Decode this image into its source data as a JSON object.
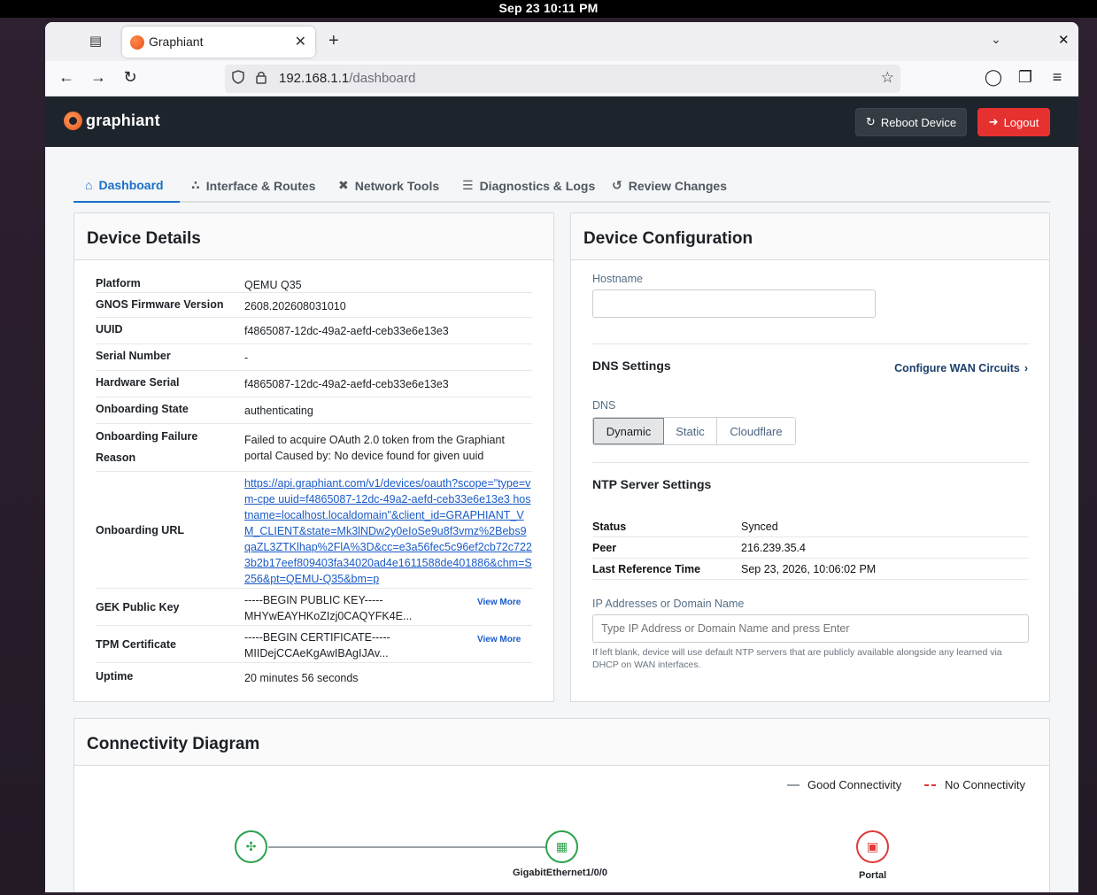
{
  "system": {
    "clock": "Sep 23  10:11 PM"
  },
  "browser": {
    "tab_title": "Graphiant",
    "url_host": "192.168.1.1",
    "url_path": "/dashboard"
  },
  "app": {
    "brand": "graphiant",
    "reboot_label": "Reboot Device",
    "logout_label": "Logout"
  },
  "nav_tabs": [
    {
      "label": "Dashboard",
      "icon": "home-icon"
    },
    {
      "label": "Interface & Routes",
      "icon": "share-icon"
    },
    {
      "label": "Network Tools",
      "icon": "tools-icon"
    },
    {
      "label": "Diagnostics & Logs",
      "icon": "sliders-icon"
    },
    {
      "label": "Review Changes",
      "icon": "history-icon"
    }
  ],
  "device_details": {
    "title": "Device Details",
    "rows": [
      {
        "label": "Platform",
        "value": "QEMU Q35"
      },
      {
        "label": "GNOS Firmware Version",
        "value": "2608.202608031010"
      },
      {
        "label": "UUID",
        "value": "f4865087-12dc-49a2-aefd-ceb33e6e13e3"
      },
      {
        "label": "Serial Number",
        "value": "-"
      },
      {
        "label": "Hardware Serial",
        "value": "f4865087-12dc-49a2-aefd-ceb33e6e13e3"
      },
      {
        "label": "Onboarding State",
        "value": "authenticating"
      },
      {
        "label": "Onboarding Failure Reason",
        "value": "Failed to acquire OAuth 2.0 token from the Graphiant portal Caused by: No device found for given uuid"
      },
      {
        "label": "Onboarding URL",
        "value": "https://api.graphiant.com/v1/devices/oauth?scope=\"type=vm-cpe uuid=f4865087-12dc-49a2-aefd-ceb33e6e13e3 hostname=localhost.localdomain\"&client_id=GRAPHIANT_VM_CLIENT&state=Mk3lNDw2y0eIoSe9u8f3vmz%2Bebs9qaZL3ZTKlhap%2FlA%3D&cc=e3a56fec5c96ef2cb72c7223b2b17eef809403fa34020ad4e1611588de401886&chm=S256&pt=QEMU-Q35&bm=p"
      },
      {
        "label": "GEK Public Key",
        "value": "-----BEGIN PUBLIC KEY----- MHYwEAYHKoZIzj0CAQYFK4E...",
        "more": "View More"
      },
      {
        "label": "TPM Certificate",
        "value": "-----BEGIN CERTIFICATE----- MIIDejCCAeKgAwIBAgIJAv...",
        "more": "View More"
      },
      {
        "label": "Uptime",
        "value": "20 minutes 56 seconds"
      }
    ]
  },
  "device_config": {
    "title": "Device Configuration",
    "hostname_label": "Hostname",
    "hostname_value": "",
    "dns_title": "DNS Settings",
    "configure_wan": "Configure WAN Circuits",
    "dns_label": "DNS",
    "dns_options": [
      "Dynamic",
      "Static",
      "Cloudflare"
    ],
    "dns_selected": "Dynamic",
    "ntp_title": "NTP Server Settings",
    "ntp_rows": [
      {
        "label": "Status",
        "value": "Synced"
      },
      {
        "label": "Peer",
        "value": "216.239.35.4"
      },
      {
        "label": "Last Reference Time",
        "value": "Sep 23, 2026, 10:06:02 PM"
      }
    ],
    "ip_label": "IP Addresses or Domain Name",
    "ip_placeholder": "Type IP Address or Domain Name and press Enter",
    "ip_help": "If left blank, device will use default NTP servers that are publicly available alongside any learned via DHCP on WAN interfaces."
  },
  "connectivity": {
    "title": "Connectivity Diagram",
    "legend_good": "Good Connectivity",
    "legend_none": "No Connectivity",
    "nodes": [
      {
        "label": "",
        "status": "good",
        "icon": "router-icon"
      },
      {
        "label": "GigabitEthernet1/0/0",
        "status": "good",
        "icon": "interface-icon"
      },
      {
        "label": "Portal",
        "status": "none",
        "icon": "portal-icon"
      }
    ],
    "colors": {
      "good": "#2ba24c",
      "none": "#e03a3a"
    }
  }
}
